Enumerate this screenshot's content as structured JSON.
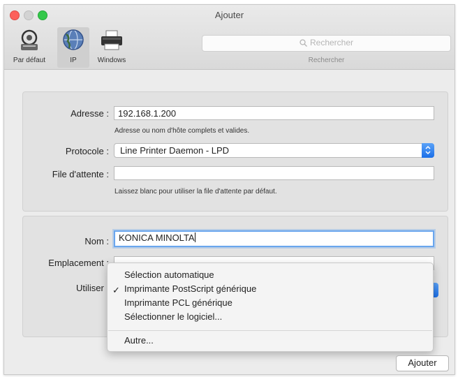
{
  "window": {
    "title": "Ajouter"
  },
  "toolbar": {
    "buttons": [
      {
        "label": "Par défaut",
        "icon": "default-printer-icon"
      },
      {
        "label": "IP",
        "icon": "ip-globe-icon",
        "selected": true
      },
      {
        "label": "Windows",
        "icon": "windows-printer-icon"
      }
    ],
    "search": {
      "placeholder": "Rechercher",
      "caption": "Rechercher"
    }
  },
  "connection": {
    "address_label": "Adresse :",
    "address_value": "192.168.1.200",
    "address_hint": "Adresse ou nom d'hôte complets et valides.",
    "protocol_label": "Protocole :",
    "protocol_value": "Line Printer Daemon - LPD",
    "queue_label": "File d'attente :",
    "queue_value": "",
    "queue_hint": "Laissez blanc pour utiliser la file d'attente par défaut."
  },
  "printer": {
    "name_label": "Nom :",
    "name_value": "KONICA MINOLTA",
    "location_label": "Emplacement :",
    "use_label": "Utiliser :"
  },
  "use_menu": {
    "items": [
      {
        "label": "Sélection automatique",
        "checked": false
      },
      {
        "label": "Imprimante PostScript générique",
        "checked": true
      },
      {
        "label": "Imprimante PCL générique",
        "checked": false
      },
      {
        "label": "Sélectionner le logiciel...",
        "checked": false
      }
    ],
    "other_label": "Autre...",
    "check_glyph": "✓"
  },
  "actions": {
    "add_label": "Ajouter"
  },
  "colors": {
    "accent": "#1b6fe8",
    "focus_ring": "#6aa6ee",
    "close": "#fc605b",
    "zoom": "#34c84a"
  }
}
